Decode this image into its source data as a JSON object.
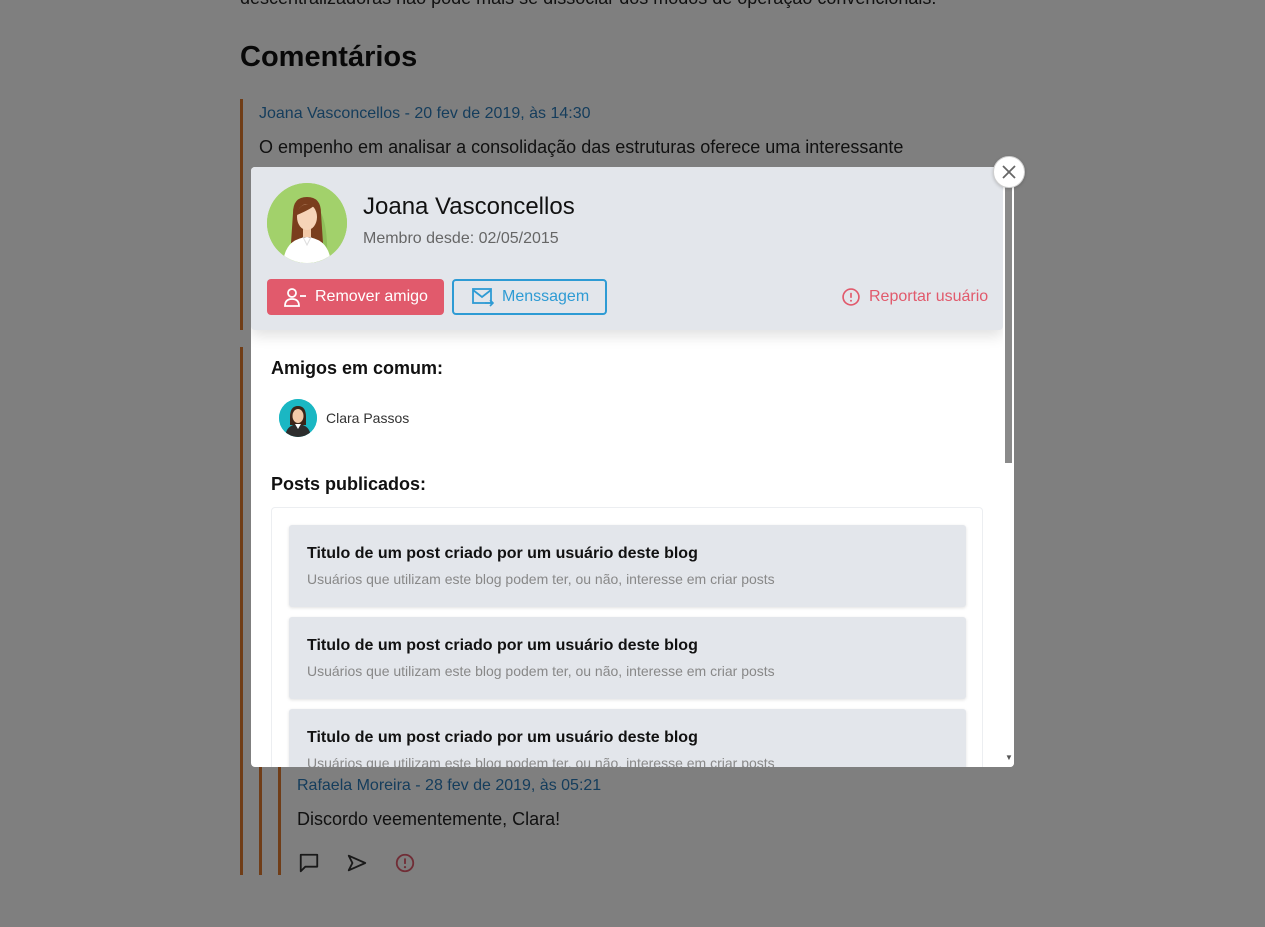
{
  "page": {
    "cut_off_text": "descentralizadoras não pode mais se dissociar dos modos de operação convencionais.",
    "section_title": "Comentários"
  },
  "comments": [
    {
      "meta": "Joana Vasconcellos - 20 fev de 2019, às 14:30",
      "text": "O empenho em analisar a consolidação das estruturas oferece uma interessante"
    },
    {
      "meta": "Rafaela Moreira - 28 fev de 2019, às 05:21",
      "text": "Discordo veementemente, Clara!"
    }
  ],
  "comment_actions": {
    "reply_icon": "comment-icon",
    "share_icon": "send-icon",
    "report_icon": "alert-circle-icon"
  },
  "profile_modal": {
    "name": "Joana Vasconcellos",
    "member_since": "Membro desde: 02/05/2015",
    "remove_friend_label": "Remover amigo",
    "message_label": "Menssagem",
    "report_label": "Reportar usuário",
    "mutual_friends_title": "Amigos em comum:",
    "mutual_friends": [
      {
        "name": "Clara Passos"
      }
    ],
    "posts_title": "Posts publicados:",
    "posts": [
      {
        "title": "Titulo de um post criado por um usuário deste blog",
        "subtitle": "Usuários que utilizam este blog podem ter, ou não, interesse em criar posts"
      },
      {
        "title": "Titulo de um post criado por um usuário deste blog",
        "subtitle": "Usuários que utilizam este blog podem ter, ou não, interesse em criar posts"
      },
      {
        "title": "Titulo de um post criado por um usuário deste blog",
        "subtitle": "Usuários que utilizam este blog podem ter, ou não, interesse em criar posts"
      }
    ]
  },
  "colors": {
    "accent_orange": "#e07a2e",
    "link_blue": "#2a7ab8",
    "danger": "#e15a6c",
    "message_blue": "#2e9bd4"
  }
}
